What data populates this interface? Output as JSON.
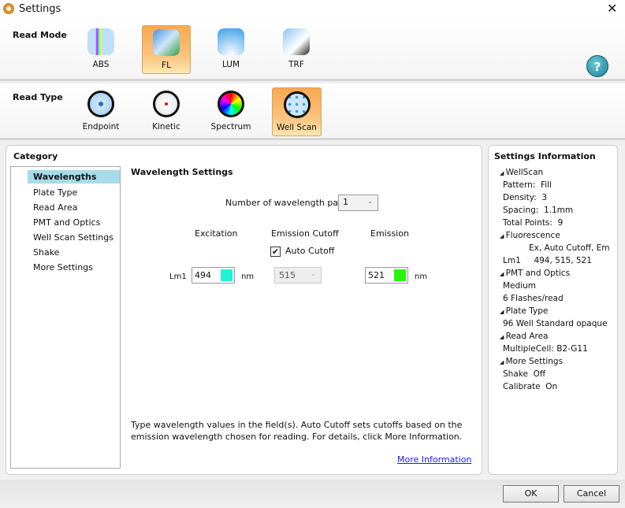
{
  "window": {
    "title": "Settings"
  },
  "read_mode": {
    "label": "Read Mode",
    "items": [
      {
        "label": "ABS"
      },
      {
        "label": "FL"
      },
      {
        "label": "LUM"
      },
      {
        "label": "TRF"
      }
    ],
    "selected": "FL"
  },
  "read_type": {
    "label": "Read Type",
    "items": [
      {
        "label": "Endpoint"
      },
      {
        "label": "Kinetic"
      },
      {
        "label": "Spectrum"
      },
      {
        "label": "Well Scan"
      }
    ],
    "selected": "Well Scan"
  },
  "help": "?",
  "category": {
    "title": "Category",
    "items": [
      "Wavelengths",
      "Plate Type",
      "Read Area",
      "PMT and Optics",
      "Well Scan Settings",
      "Shake",
      "More Settings"
    ]
  },
  "wavelength": {
    "title": "Wavelength Settings",
    "pairs_label": "Number of wavelength pairs",
    "pairs_value": "1",
    "col_excitation": "Excitation",
    "col_cutoff": "Emission Cutoff",
    "col_emission": "Emission",
    "auto_cutoff_label": "Auto Cutoff",
    "auto_cutoff_checked": true,
    "row_label": "Lm1",
    "excitation": "494",
    "cutoff": "515",
    "emission": "521",
    "unit": "nm",
    "excitation_color": "#1ef5d6",
    "emission_color": "#27f505",
    "help_text": "Type wavelength values in the field(s). Auto Cutoff sets cutoffs based on the emission wavelength chosen for reading. For details, click More Information.",
    "more_info": "More Information"
  },
  "info": {
    "title": "Settings Information",
    "lines": [
      {
        "t": "WellScan",
        "h": true
      },
      {
        "t": "Pattern:  Fill"
      },
      {
        "t": "Density:  3"
      },
      {
        "t": "Spacing:  1.1mm"
      },
      {
        "t": "Total Points:  9"
      },
      {
        "t": "Fluorescence",
        "h": true
      },
      {
        "t": "Ex, Auto Cutoff, Em",
        "indent": true
      },
      {
        "t": "Lm1     494, 515, 521"
      },
      {
        "t": "PMT and Optics",
        "h": true
      },
      {
        "t": "Medium"
      },
      {
        "t": "6 Flashes/read"
      },
      {
        "t": "Plate Type",
        "h": true
      },
      {
        "t": "96 Well Standard opaque"
      },
      {
        "t": "Read Area",
        "h": true
      },
      {
        "t": "MultipleCell: B2-G11"
      },
      {
        "t": "More Settings",
        "h": true
      },
      {
        "t": "Shake  Off"
      },
      {
        "t": "Calibrate  On"
      }
    ]
  },
  "buttons": {
    "ok": "OK",
    "cancel": "Cancel"
  }
}
